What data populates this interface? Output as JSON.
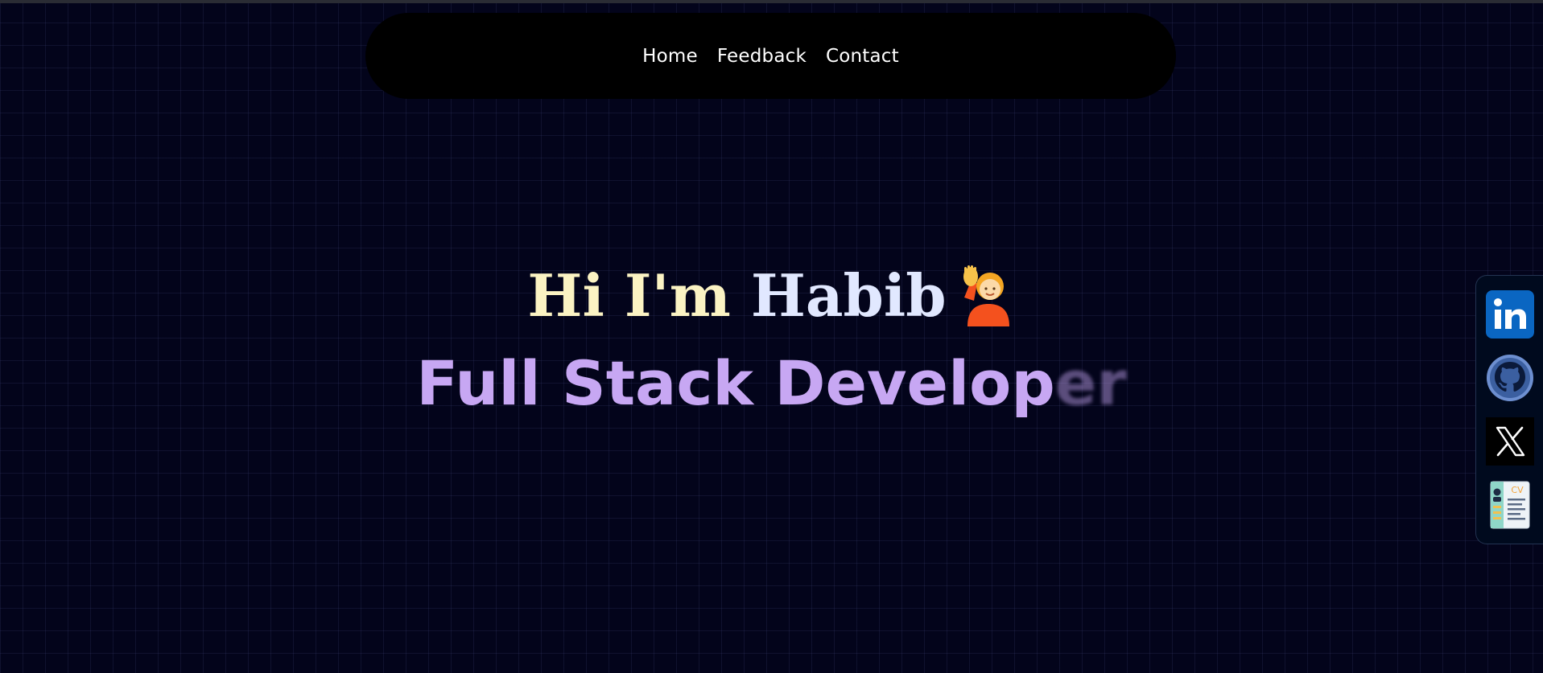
{
  "nav": {
    "items": [
      {
        "label": "Home"
      },
      {
        "label": "Feedback"
      },
      {
        "label": "Contact"
      }
    ]
  },
  "hero": {
    "greeting_part1": "Hi I'm ",
    "greeting_part2": "Habib",
    "greeting_icon": "waving-person-icon",
    "role_main": "Full Stack Develop",
    "role_fading": "er"
  },
  "social": {
    "items": [
      {
        "name": "linkedin-icon",
        "label": "in",
        "color": "#0a66c2"
      },
      {
        "name": "github-icon",
        "color": "#3b5fa0"
      },
      {
        "name": "x-icon",
        "color": "#000000"
      },
      {
        "name": "cv-icon",
        "label": "CV",
        "color": "#8fd6c8"
      }
    ]
  },
  "colors": {
    "background": "#03041b",
    "navbar": "#000000",
    "greeting_light": "#fbf3c3",
    "greeting_name": "#e1e8ff",
    "role": "#c7a7f3"
  }
}
